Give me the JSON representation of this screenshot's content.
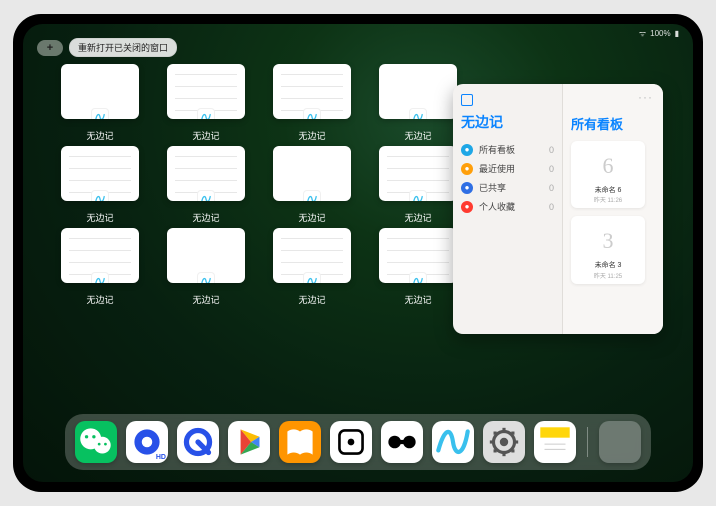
{
  "status": {
    "battery": "100%"
  },
  "topbar": {
    "plus": "+",
    "reopen_label": "重新打开已关闭的窗口"
  },
  "window_tiles": {
    "app_name": "无边记",
    "items": [
      {
        "label": "无边记",
        "variant": "blank"
      },
      {
        "label": "无边记",
        "variant": "lines"
      },
      {
        "label": "无边记",
        "variant": "lines"
      },
      {
        "label": "无边记",
        "variant": "blank"
      },
      {
        "label": "无边记",
        "variant": "lines"
      },
      {
        "label": "无边记",
        "variant": "lines"
      },
      {
        "label": "无边记",
        "variant": "blank"
      },
      {
        "label": "无边记",
        "variant": "lines"
      },
      {
        "label": "无边记",
        "variant": "lines"
      },
      {
        "label": "无边记",
        "variant": "blank"
      },
      {
        "label": "无边记",
        "variant": "lines"
      },
      {
        "label": "无边记",
        "variant": "lines"
      }
    ]
  },
  "panel": {
    "left_title": "无边记",
    "right_title": "所有看板",
    "more": "···",
    "nav": [
      {
        "icon_color": "#1ea7e6",
        "label": "所有看板",
        "count": "0"
      },
      {
        "icon_color": "#ff9f0a",
        "label": "最近使用",
        "count": "0"
      },
      {
        "icon_color": "#2f6fe4",
        "label": "已共享",
        "count": "0"
      },
      {
        "icon_color": "#ff3b30",
        "label": "个人收藏",
        "count": "0"
      }
    ],
    "boards": [
      {
        "glyph": "6",
        "title": "未命名 6",
        "sub": "昨天 11:26"
      },
      {
        "glyph": "3",
        "title": "未命名 3",
        "sub": "昨天 11:25"
      }
    ]
  },
  "dock": {
    "icons": [
      {
        "name": "wechat",
        "bg": "#07c160",
        "kind": "wechat"
      },
      {
        "name": "quark-hd",
        "bg": "#ffffff",
        "kind": "quark",
        "badge": "HD"
      },
      {
        "name": "quark",
        "bg": "#ffffff",
        "kind": "quark-ring"
      },
      {
        "name": "play",
        "bg": "#ffffff",
        "kind": "play"
      },
      {
        "name": "books",
        "bg": "#ff9500",
        "kind": "books"
      },
      {
        "name": "dice",
        "bg": "#ffffff",
        "kind": "die"
      },
      {
        "name": "connect",
        "bg": "#ffffff",
        "kind": "barbell"
      },
      {
        "name": "freeform",
        "bg": "#ffffff",
        "kind": "freeform"
      },
      {
        "name": "settings",
        "bg": "#dedede",
        "kind": "gear"
      },
      {
        "name": "notes",
        "bg": "#ffffff",
        "kind": "notes"
      }
    ]
  }
}
